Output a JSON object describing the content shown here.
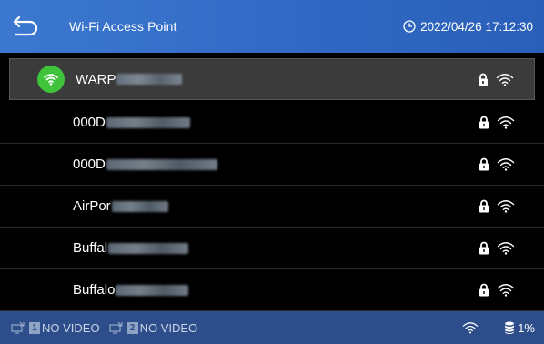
{
  "header": {
    "title": "Wi-Fi Access Point",
    "datetime": "2022/04/26 17:12:30"
  },
  "networks": [
    {
      "ssid": "WARP",
      "connected": true,
      "secured": true
    },
    {
      "ssid": "000D",
      "connected": false,
      "secured": true
    },
    {
      "ssid": "000D",
      "connected": false,
      "secured": true
    },
    {
      "ssid": "AirPor",
      "connected": false,
      "secured": true
    },
    {
      "ssid": "Buffal",
      "connected": false,
      "secured": true
    },
    {
      "ssid": "Buffalo",
      "connected": false,
      "secured": true
    }
  ],
  "footer": {
    "cam1_num": "1",
    "cam1_label": "NO VIDEO",
    "cam2_num": "2",
    "cam2_label": "NO VIDEO",
    "storage": "1%"
  },
  "colors": {
    "header_bg": "#3c78d0",
    "footer_bg": "#2d4e8a",
    "connected_green": "#3fc33a",
    "selected_row": "#3b3b3b"
  }
}
